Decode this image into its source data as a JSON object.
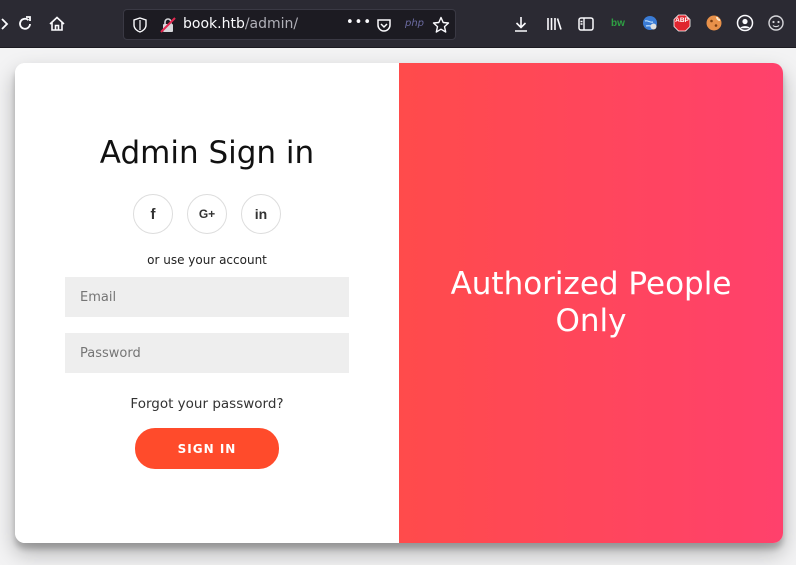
{
  "browser": {
    "url_host": "book.htb",
    "url_path": "/admin/",
    "more_label": "•••",
    "php_badge": "php",
    "ext_bw": "bw",
    "ext_abp": "ABP"
  },
  "form": {
    "title": "Admin Sign in",
    "social": [
      {
        "label": "f",
        "name": "facebook"
      },
      {
        "label": "G+",
        "name": "google-plus"
      },
      {
        "label": "in",
        "name": "linkedin"
      }
    ],
    "alt_text": "or use your account",
    "email_placeholder": "Email",
    "password_placeholder": "Password",
    "forgot_link": "Forgot your password?",
    "submit_label": "SIGN IN"
  },
  "overlay": {
    "text": "Authorized People Only"
  },
  "colors": {
    "accent": "#ff4b2b",
    "gradient_start": "#ff4b4b",
    "gradient_end": "#ff416c"
  }
}
